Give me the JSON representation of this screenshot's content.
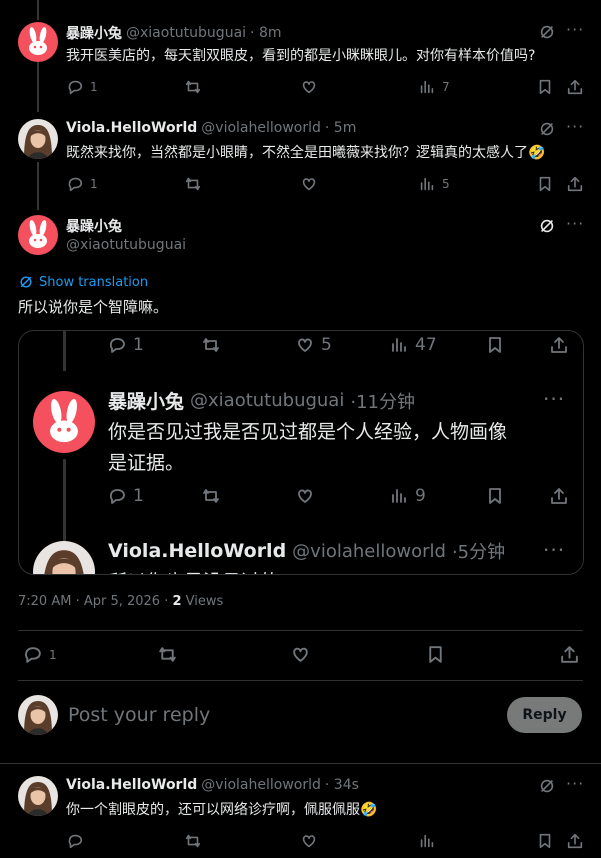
{
  "posts": [
    {
      "name": "暴躁小兔",
      "handle": "@xiaotutubuguai",
      "time": "· 8m",
      "text": "我开医美店的，每天割双眼皮，看到的都是小眯眯眼儿。对你有样本价值吗?",
      "replies": "1",
      "views": "7"
    },
    {
      "name": "Viola.HelloWorld",
      "handle": "@violahelloworld",
      "time": "· 5m",
      "text": "既然来找你，当然都是小眼睛，不然全是田曦薇来找你？逻辑真的太感人了🤣",
      "replies": "1",
      "views": "5"
    }
  ],
  "main_post": {
    "name": "暴躁小兔",
    "handle": "@xiaotutubuguai",
    "show_translation": "Show translation",
    "text": "所以说你是个智障嘛。",
    "timestamp": "7:20 AM · Apr 5, 2026 · ",
    "views_count": "2",
    "views_label": " Views",
    "replies": "1"
  },
  "quote": {
    "top_actions": {
      "replies": "1",
      "retweets": "",
      "likes": "5",
      "views": "47"
    },
    "post1": {
      "name": "暴躁小兔",
      "handle": "@xiaotutubuguai",
      "time": "·11分钟",
      "text_line1": "你是否见过我是否见过都是个人经验，人物画像",
      "text_line2": "是证据。",
      "replies": "1",
      "views": "9"
    },
    "post2": {
      "name": "Viola.HelloWorld",
      "handle": "@violahelloworld",
      "time": "·5分钟",
      "text_partial": "所以你也是没见过的"
    }
  },
  "composer": {
    "placeholder": "Post your reply",
    "reply_label": "Reply"
  },
  "last_post": {
    "name": "Viola.HelloWorld",
    "handle": "@violahelloworld",
    "time": "· 34s",
    "text": "你一个割眼皮的，还可以网络诊疗啊，佩服佩服🤣"
  },
  "colors": {
    "background": "#000000",
    "text": "#e7e9ea",
    "muted": "#71767b",
    "link": "#1d9bf0",
    "rabbit_avatar": "#f4505e",
    "reply_button": "#787a7a"
  },
  "icons": [
    "reply-icon",
    "retweet-icon",
    "like-icon",
    "views-icon",
    "bookmark-icon",
    "share-icon",
    "grok-icon",
    "more-icon"
  ]
}
